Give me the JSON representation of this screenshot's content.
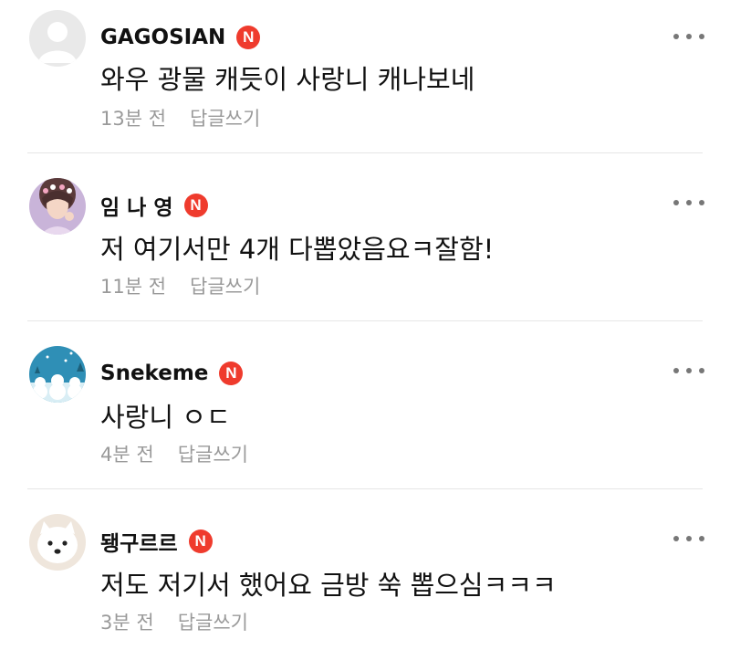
{
  "comments": [
    {
      "author": "GAGOSIAN",
      "badge": "N",
      "text": "와우 광물 캐듯이 사랑니 캐나보네",
      "time": "13분 전",
      "reply": "답글쓰기",
      "avatar_icon": "default-profile-icon"
    },
    {
      "author": "임 나 영",
      "badge": "N",
      "text": "저 여기서만 4개 다뽑았음요ㅋ잘함!",
      "time": "11분 전",
      "reply": "답글쓰기",
      "avatar_icon": "girl-photo"
    },
    {
      "author": "Snekeme",
      "badge": "N",
      "text": "사랑니 ㅇㄷ",
      "time": "4분 전",
      "reply": "답글쓰기",
      "avatar_icon": "snowmen-photo"
    },
    {
      "author": "됑구르르",
      "badge": "N",
      "text": "저도 저기서 했어요 금방 쑥 뽑으심ㅋㅋㅋ",
      "time": "3분 전",
      "reply": "답글쓰기",
      "avatar_icon": "white-dog-photo"
    }
  ],
  "colors": {
    "badge": "#ef3b2d",
    "meta_text": "#9a9a9a",
    "divider": "#e6e6e6"
  }
}
